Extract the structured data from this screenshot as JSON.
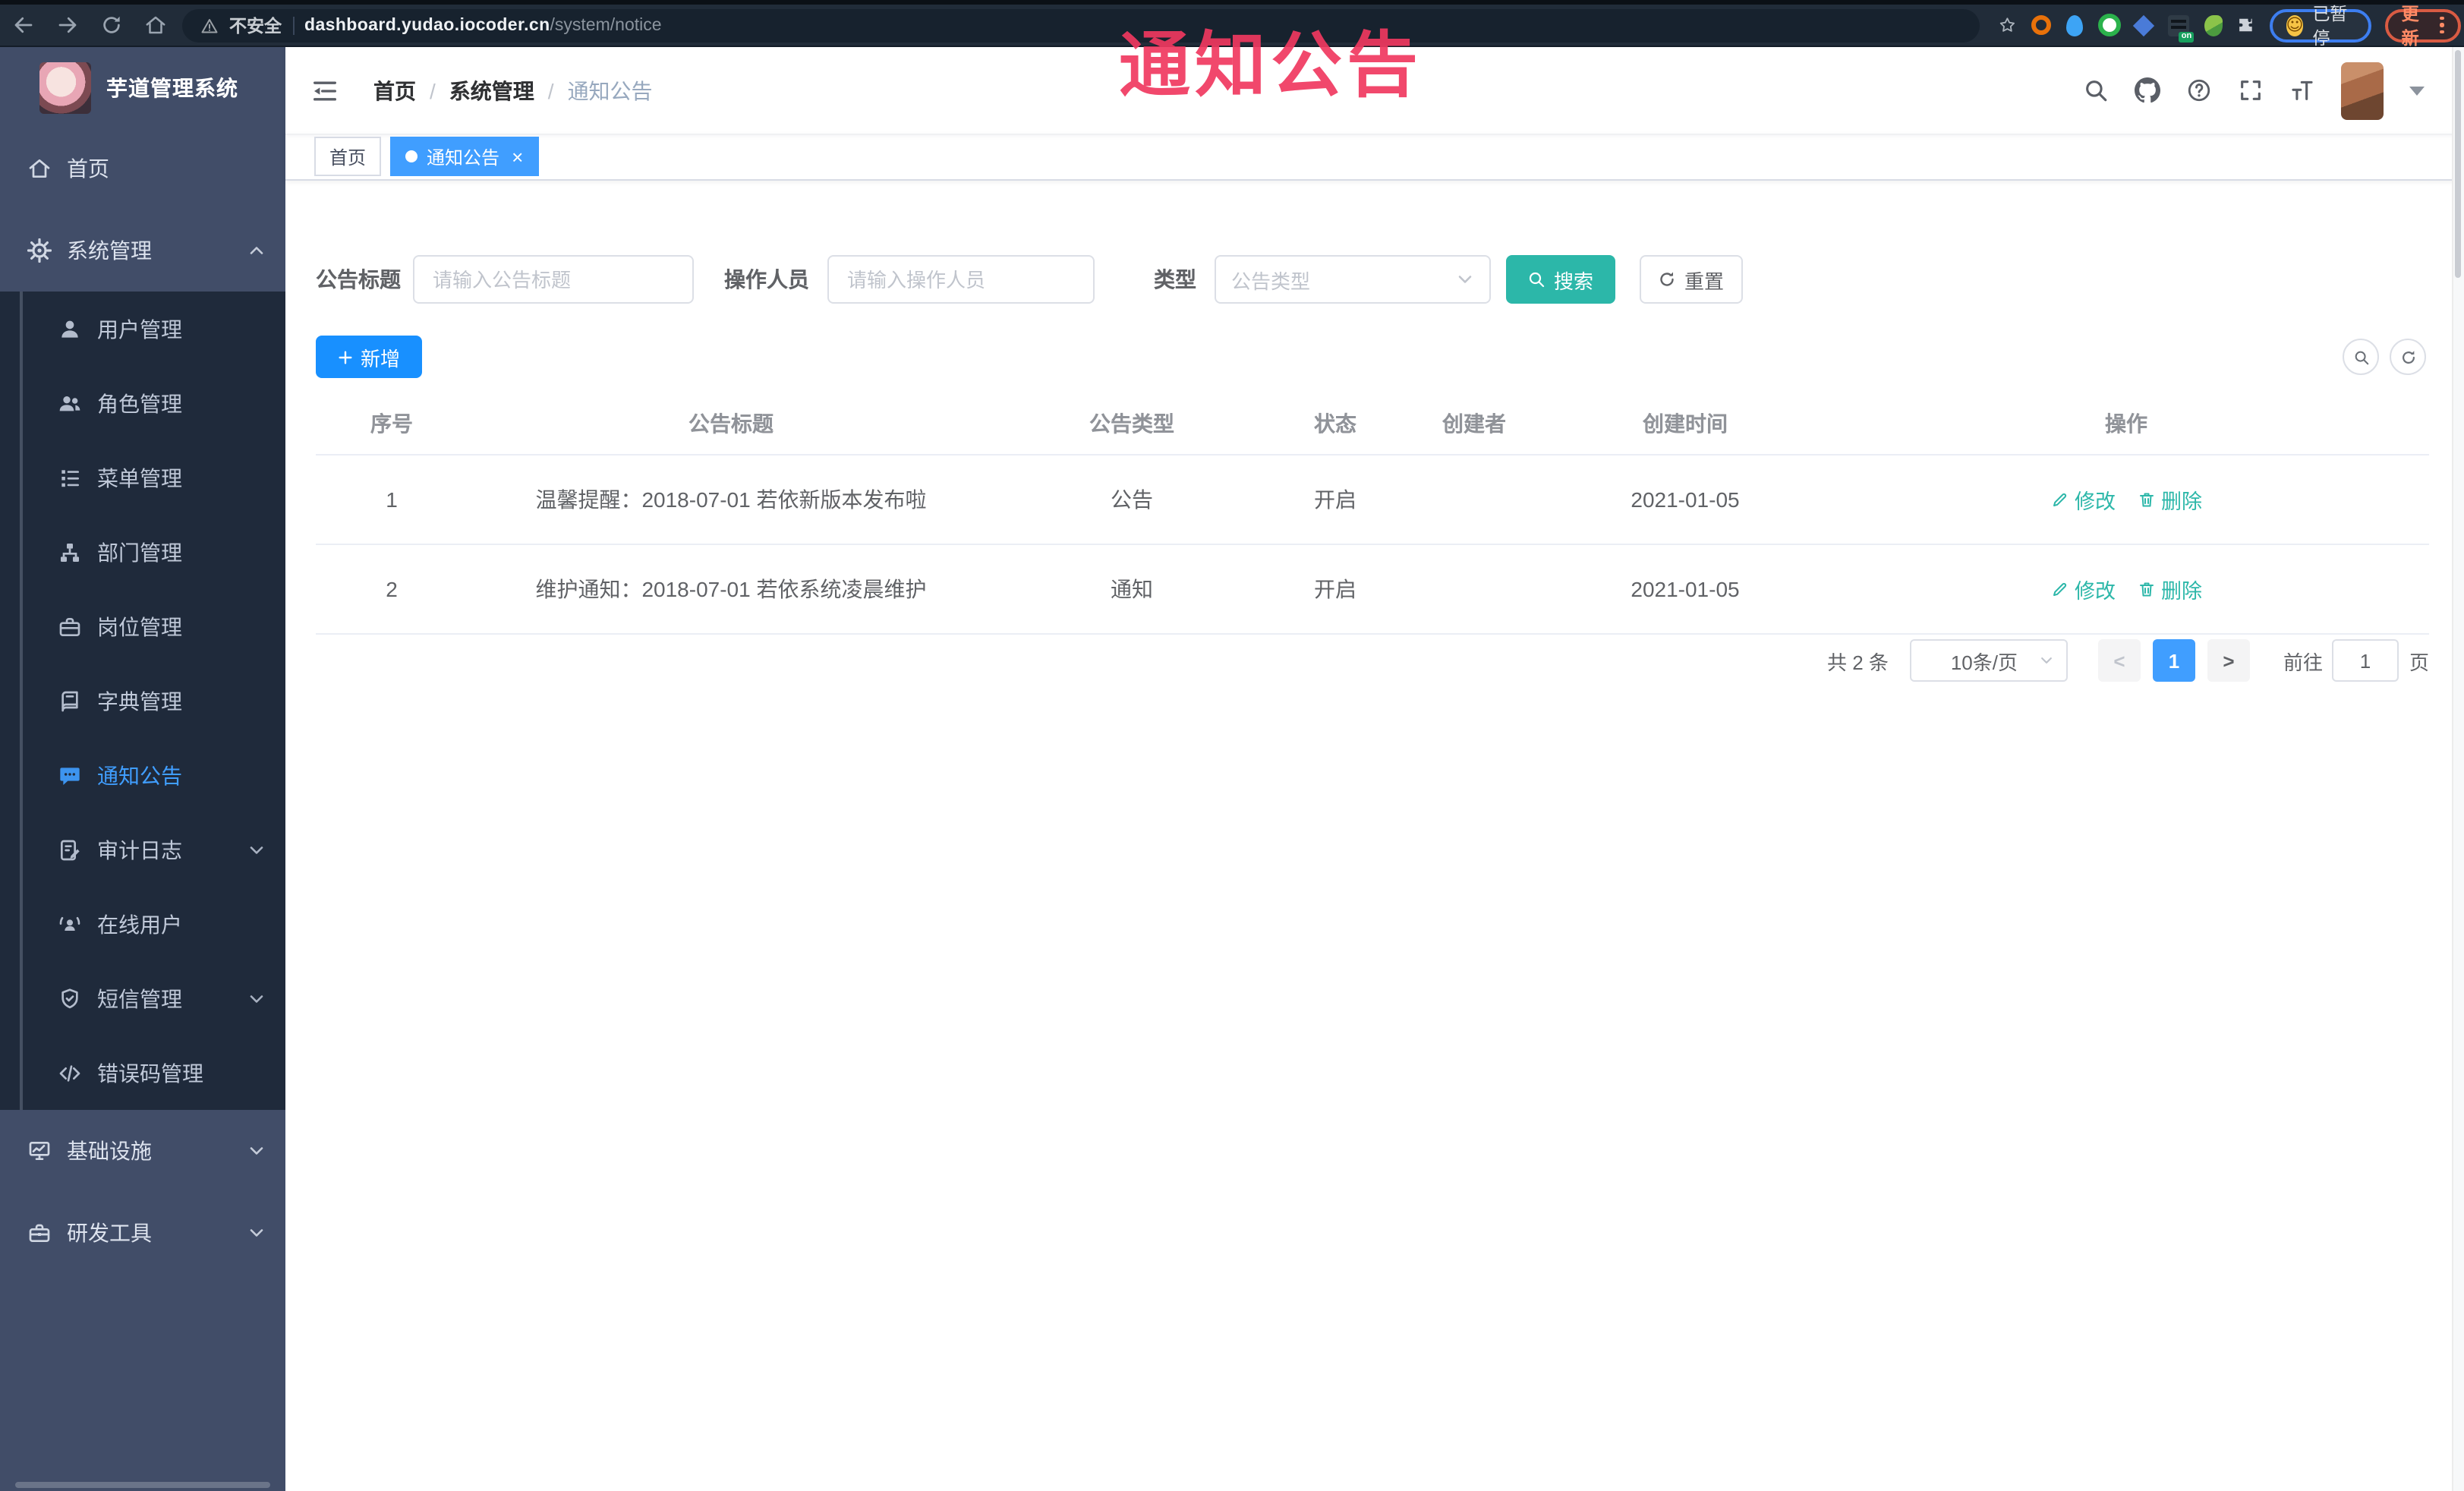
{
  "watermark_title": "通知公告",
  "browser": {
    "security_label": "不安全",
    "url_host": "dashboard.yudao.iocoder.cn",
    "url_path": "/system/notice",
    "profile_status_label": "已暂停",
    "update_button_label": "更新"
  },
  "sidebar": {
    "app_title": "芋道管理系统",
    "items": [
      {
        "id": "home",
        "label": "首页",
        "icon": "home-icon",
        "sym": "i-home",
        "level": "root"
      },
      {
        "id": "system",
        "label": "系统管理",
        "icon": "gear-icon",
        "sym": "i-gear",
        "level": "root",
        "arrow": "up"
      },
      {
        "id": "user",
        "label": "用户管理",
        "icon": "user-icon",
        "sym": "i-user",
        "level": "sub"
      },
      {
        "id": "role",
        "label": "角色管理",
        "icon": "users-icon",
        "sym": "i-users",
        "level": "sub"
      },
      {
        "id": "menu",
        "label": "菜单管理",
        "icon": "menu-tree-icon",
        "sym": "i-tree",
        "level": "sub"
      },
      {
        "id": "dept",
        "label": "部门管理",
        "icon": "org-icon",
        "sym": "i-org",
        "level": "sub"
      },
      {
        "id": "post",
        "label": "岗位管理",
        "icon": "briefcase-icon",
        "sym": "i-brief",
        "level": "sub"
      },
      {
        "id": "dict",
        "label": "字典管理",
        "icon": "book-icon",
        "sym": "i-book",
        "level": "sub"
      },
      {
        "id": "notice",
        "label": "通知公告",
        "icon": "chat-bubble-icon",
        "sym": "i-chat",
        "level": "sub",
        "active": true
      },
      {
        "id": "audit",
        "label": "审计日志",
        "icon": "audit-log-icon",
        "sym": "i-log",
        "level": "sub",
        "arrow": "down"
      },
      {
        "id": "online",
        "label": "在线用户",
        "icon": "online-user-icon",
        "sym": "i-online",
        "level": "sub"
      },
      {
        "id": "sms",
        "label": "短信管理",
        "icon": "shield-icon",
        "sym": "i-shield",
        "level": "sub",
        "arrow": "down"
      },
      {
        "id": "errcode",
        "label": "错误码管理",
        "icon": "code-icon",
        "sym": "i-code",
        "level": "sub"
      },
      {
        "id": "infra",
        "label": "基础设施",
        "icon": "monitor-icon",
        "sym": "i-monitor",
        "level": "root",
        "arrow": "down"
      },
      {
        "id": "devtool",
        "label": "研发工具",
        "icon": "toolbox-icon",
        "sym": "i-toolbox",
        "level": "root",
        "arrow": "down"
      }
    ]
  },
  "header": {
    "breadcrumb": [
      "首页",
      "系统管理",
      "通知公告"
    ]
  },
  "tabs": [
    {
      "label": "首页",
      "active": false,
      "closable": false
    },
    {
      "label": "通知公告",
      "active": true,
      "closable": true
    }
  ],
  "filters": {
    "title_label": "公告标题",
    "title_placeholder": "请输入公告标题",
    "operator_label": "操作人员",
    "operator_placeholder": "请输入操作人员",
    "type_label": "类型",
    "type_placeholder": "公告类型",
    "search_label": "搜索",
    "reset_label": "重置"
  },
  "toolbar": {
    "add_label": "新增"
  },
  "table": {
    "headers": [
      "序号",
      "公告标题",
      "公告类型",
      "状态",
      "创建者",
      "创建时间",
      "操作"
    ],
    "rows": [
      {
        "no": "1",
        "title": "温馨提醒：2018-07-01 若依新版本发布啦",
        "type": "公告",
        "status": "开启",
        "creator": "",
        "time": "2021-01-05"
      },
      {
        "no": "2",
        "title": "维护通知：2018-07-01 若依系统凌晨维护",
        "type": "通知",
        "status": "开启",
        "creator": "",
        "time": "2021-01-05"
      }
    ],
    "edit_label": "修改",
    "delete_label": "删除"
  },
  "pagination": {
    "total": "共 2 条",
    "page_size": "10条/页",
    "prev": "<",
    "next": ">",
    "current_page": "1",
    "goto_label": "前往",
    "goto_value": "1",
    "unit_label": "页"
  },
  "colors": {
    "accent_blue": "#409eff",
    "add_button_blue": "#1890ff",
    "theme_teal": "#2cb7a9",
    "watermark_pink": "#f03860",
    "sidebar_bg": "#414d68",
    "submenu_bg": "#1f2a3b",
    "browser_bar_bg": "#212c39"
  }
}
